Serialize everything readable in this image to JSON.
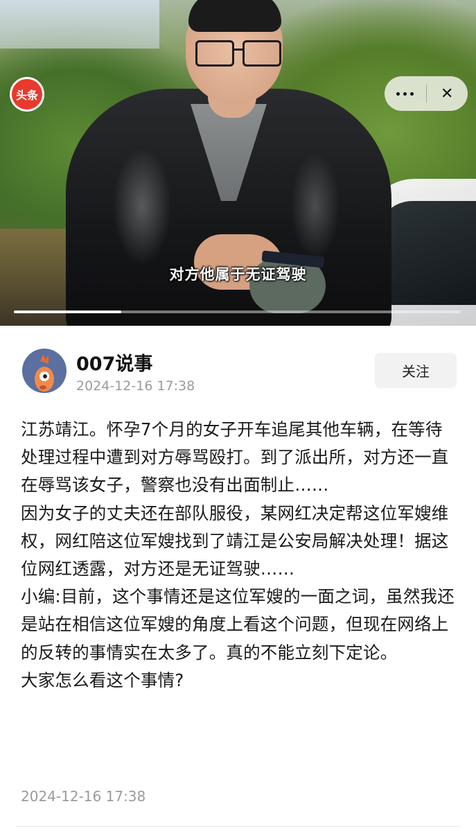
{
  "video": {
    "subtitle": "对方他属于无证驾驶",
    "progress": 0.24,
    "logo_text": "头条",
    "more_icon": "more-dots-icon",
    "close_icon": "close-icon",
    "close_glyph": "✕"
  },
  "post": {
    "author": "007说事",
    "time": "2024-12-16 17:38",
    "follow_label": "关注",
    "paragraphs": [
      "江苏靖江。怀孕7个月的女子开车追尾其他车辆，在等待处理过程中遭到对方辱骂殴打。到了派出所，对方还一直在辱骂该女子，警察也没有出面制止……",
      "因为女子的丈夫还在部队服役，某网红决定帮这位军嫂维权，网红陪这位军嫂找到了靖江是公安局解决处理！据这位网红透露，对方还是无证驾驶……",
      "小编:目前，这个事情还是这位军嫂的一面之词，虽然我还是站在相信这位军嫂的角度上看这个问题，但现在网络上的反转的事情实在太多了。真的不能立刻下定论。",
      "大家怎么看这个事情?"
    ],
    "footer_time": "2024-12-16 17:38"
  }
}
